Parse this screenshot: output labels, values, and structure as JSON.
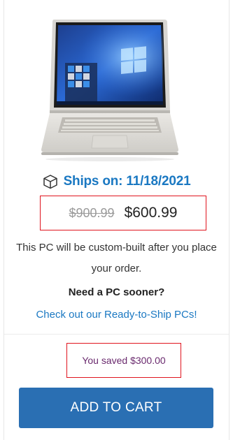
{
  "product": {
    "image_icon": "laptop-product-image",
    "ships_icon": "box-icon",
    "ships_label": "Ships on: 11/18/2021",
    "price_original": "$900.99",
    "price_current": "$600.99",
    "build_note": "This PC will be custom-built after you place your order.",
    "need_sooner": "Need a PC sooner?",
    "ready_link": "Check out our Ready-to-Ship PCs!",
    "saved_text": "You saved $300.00",
    "add_to_cart_label": "ADD TO CART"
  },
  "colors": {
    "accent_blue": "#1a78c2",
    "button_blue": "#2a6fb3",
    "highlight_red": "#e0141e",
    "saved_purple": "#6a2a6e"
  }
}
